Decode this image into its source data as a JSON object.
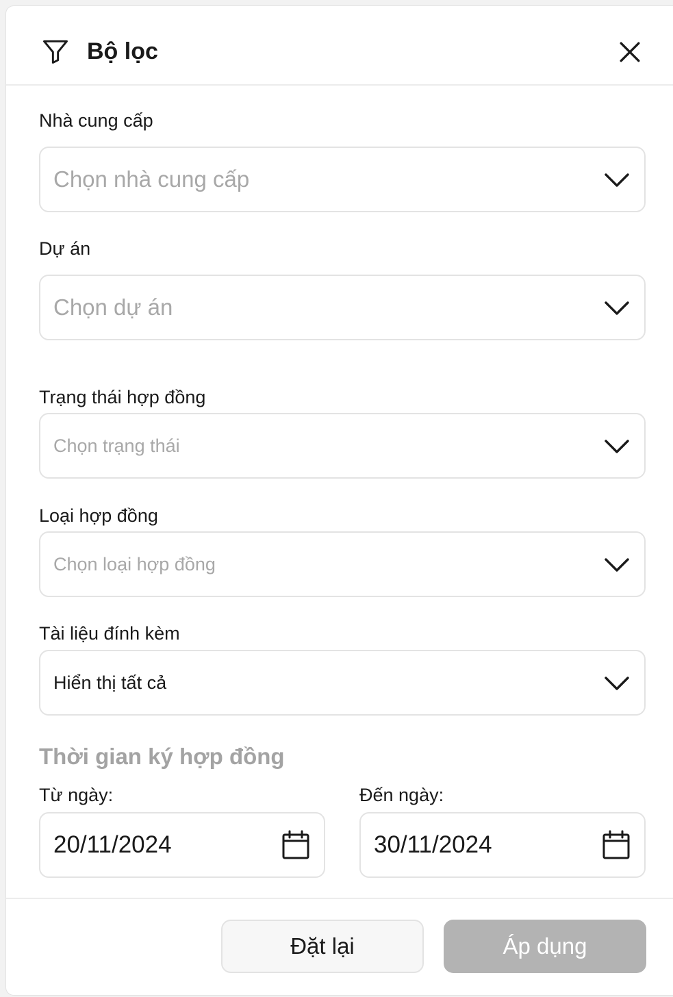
{
  "header": {
    "title": "Bộ lọc",
    "icons": {
      "filter": "filter-icon",
      "close": "close-icon"
    }
  },
  "fields": {
    "supplier": {
      "label": "Nhà cung cấp",
      "placeholder": "Chọn nhà cung cấp"
    },
    "project": {
      "label": "Dự án",
      "placeholder": "Chọn dự án"
    },
    "contract_status": {
      "label": "Trạng thái hợp đồng",
      "placeholder": "Chọn trạng thái"
    },
    "contract_type": {
      "label": "Loại hợp đồng",
      "placeholder": "Chọn loại hợp đồng"
    },
    "attachments": {
      "label": "Tài liệu đính kèm",
      "value": "Hiển thị tất cả"
    }
  },
  "signing_period": {
    "title": "Thời gian ký hợp đồng",
    "from": {
      "label": "Từ ngày:",
      "value": "20/11/2024"
    },
    "to": {
      "label": "Đến ngày:",
      "value": "30/11/2024"
    }
  },
  "footer": {
    "reset_label": "Đặt lại",
    "apply_label": "Áp dụng"
  },
  "colors": {
    "border": "#e3e3e3",
    "placeholder": "#a8a8a8",
    "apply_disabled_bg": "#b3b3b3",
    "section_title": "#a3a3a3"
  }
}
